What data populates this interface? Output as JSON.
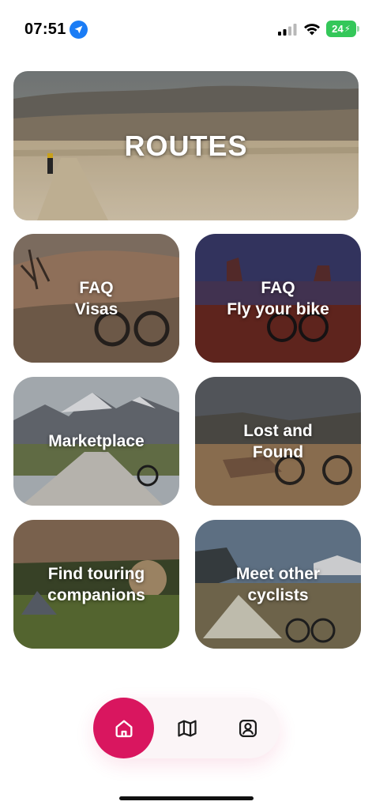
{
  "status_bar": {
    "time": "07:51",
    "battery": "24"
  },
  "hero": {
    "label": "ROUTES"
  },
  "cards": [
    {
      "label": "FAQ\nVisas"
    },
    {
      "label": "FAQ\nFly your bike"
    },
    {
      "label": "Marketplace"
    },
    {
      "label": "Lost and\nFound"
    },
    {
      "label": "Find touring\ncompanions"
    },
    {
      "label": "Meet other\ncyclists"
    }
  ],
  "nav": {
    "items": [
      "home-icon",
      "map-icon",
      "profile-icon"
    ],
    "active": "home",
    "accent_color": "#d9165f"
  }
}
